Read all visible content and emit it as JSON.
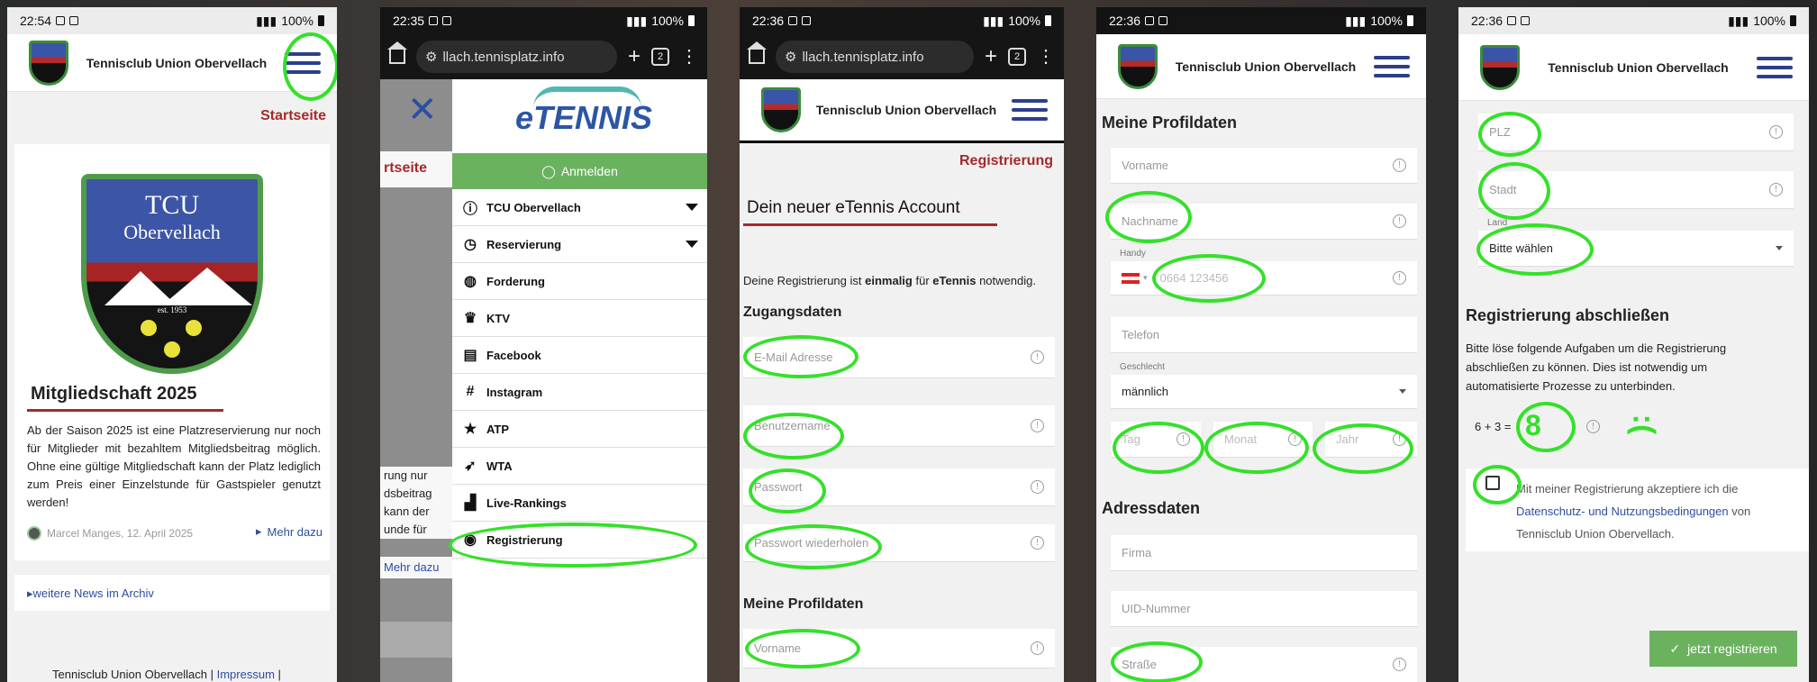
{
  "site": {
    "club_name": "Tennisclub Union Obervellach",
    "crest_line1": "TCU",
    "crest_line2": "Obervellach",
    "crest_est": "est. 1953"
  },
  "colors": {
    "accent_red": "#a52a2a",
    "nav_blue": "#2c3e8c",
    "link_blue": "#2c4ea3",
    "green": "#6bb25f",
    "annotation": "#35e02a"
  },
  "screen1": {
    "time": "22:54",
    "battery": "100%",
    "page_title": "Startseite",
    "article_title": "Mitgliedschaft 2025",
    "article_text": "Ab der Saison 2025 ist eine Platzreservierung nur noch für Mitglieder mit bezahltem Mitgliedsbeitrag möglich. Ohne eine gültige Mitgliedschaft kann der Platz lediglich zum Preis einer Einzelstunde für Gastspieler genutzt werden!",
    "author_meta": "Marcel Manges, 12. April 2025",
    "more_link": "Mehr dazu",
    "archive_link": "weitere News im Archiv",
    "footer": "Tennisclub Union Obervellach |",
    "footer_link": "Impressum",
    "footer_tail": "|"
  },
  "screen2": {
    "time": "22:35",
    "battery": "100%",
    "url": "llach.tennisplatz.info",
    "tab_count": "2",
    "behind_title": "rtseite",
    "behind_text": "rung nur\ndsbeitrag\nkann der\nunde für",
    "behind_link": "Mehr dazu",
    "logo_text": "eTENNIS",
    "login_label": "Anmelden",
    "menu": [
      {
        "label": "TCU Obervellach",
        "icon": "info-icon"
      },
      {
        "label": "Reservierung",
        "icon": "clock-icon"
      },
      {
        "label": "Forderung",
        "icon": "tennis-ball-icon"
      },
      {
        "label": "KTV",
        "icon": "trophy-icon"
      },
      {
        "label": "Facebook",
        "icon": "book-icon"
      },
      {
        "label": "Instagram",
        "icon": "hashtag-icon"
      },
      {
        "label": "ATP",
        "icon": "star-icon"
      },
      {
        "label": "WTA",
        "icon": "rocket-icon"
      },
      {
        "label": "Live-Rankings",
        "icon": "podium-icon"
      },
      {
        "label": "Registrierung",
        "icon": "user-circle-icon"
      }
    ]
  },
  "screen3": {
    "time": "22:36",
    "battery": "100%",
    "url": "llach.tennisplatz.info",
    "tab_count": "2",
    "page_title": "Registrierung",
    "heading": "Dein neuer eTennis Account",
    "intro_pre": "Deine Registrierung ist ",
    "intro_bold1": "einmalig",
    "intro_mid": " für ",
    "intro_bold2": "eTennis",
    "intro_post": " notwendig.",
    "section_access": "Zugangsdaten",
    "email_placeholder": "E-Mail Adresse",
    "username_placeholder": "Benutzername",
    "password_placeholder": "Passwort",
    "password_repeat_placeholder": "Passwort wiederholen",
    "section_profile": "Meine Profildaten",
    "firstname_placeholder": "Vorname"
  },
  "screen4": {
    "time": "22:36",
    "battery": "100%",
    "section_profile": "Meine Profildaten",
    "firstname_placeholder": "Vorname",
    "lastname_placeholder": "Nachname",
    "mobile_label": "Handy",
    "mobile_placeholder": "0664 123456",
    "phone_placeholder": "Telefon",
    "gender_label": "Geschlecht",
    "gender_value": "männlich",
    "day_placeholder": "Tag",
    "month_placeholder": "Monat",
    "year_placeholder": "Jahr",
    "section_address": "Adressdaten",
    "company_placeholder": "Firma",
    "uid_placeholder": "UID-Nummer",
    "street_placeholder": "Straße"
  },
  "screen5": {
    "time": "22:36",
    "battery": "100%",
    "zip_placeholder": "PLZ",
    "city_placeholder": "Stadt",
    "country_label": "Land",
    "country_value": "Bitte wählen",
    "section_finish": "Registrierung abschließen",
    "finish_text": "Bitte löse folgende Aufgaben um die Registrierung abschließen zu können. Dies ist notwendig um automatisierte Prozesse zu unterbinden.",
    "captcha_question": "6 + 3 =",
    "captcha_answer": "8",
    "sad_face": ":(",
    "consent_pre": "Mit meiner Registrierung akzeptiere ich die",
    "consent_link": "Datenschutz- und Nutzungsbedingungen",
    "consent_post": "von Tennisclub Union Obervellach.",
    "submit_label": "jetzt registrieren"
  }
}
